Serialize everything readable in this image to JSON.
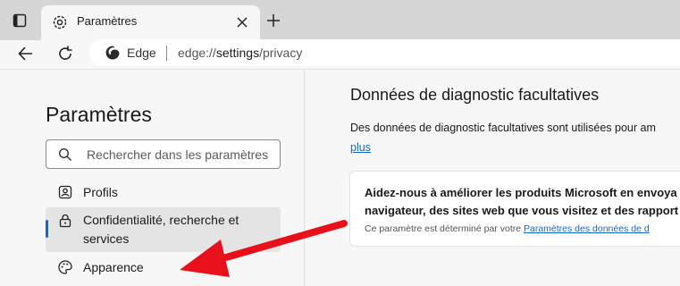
{
  "tab": {
    "title": "Paramètres"
  },
  "address_bar": {
    "site_label": "Edge",
    "url_prefix": "edge://",
    "url_highlight": "settings",
    "url_suffix": "/privacy"
  },
  "sidebar": {
    "title": "Paramètres",
    "search_placeholder": "Rechercher dans les paramètres",
    "items": [
      {
        "label": "Profils",
        "icon": "profile-icon"
      },
      {
        "label": "Confidentialité, recherche et services",
        "icon": "lock-icon",
        "active": true
      },
      {
        "label": "Apparence",
        "icon": "palette-icon"
      }
    ]
  },
  "main": {
    "section_title": "Données de diagnostic facultatives",
    "description": "Des données de diagnostic facultatives sont utilisées pour am",
    "learn_more": "plus",
    "card": {
      "title": "Aidez-nous à améliorer les produits Microsoft en envoya\nnavigateur, des sites web que vous visitez et des rapport",
      "note_text": "Ce paramètre est déterminé par votre ",
      "note_link": "Paramètres des données de d"
    }
  },
  "colors": {
    "accent": "#1668c8",
    "link": "#1567c7",
    "arrow": "#e8101a",
    "active_item_bg": "#e4e4e4"
  }
}
